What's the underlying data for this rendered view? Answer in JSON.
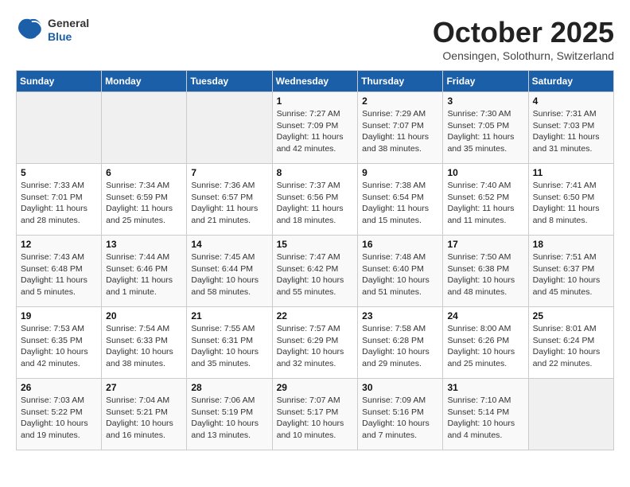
{
  "header": {
    "logo_general": "General",
    "logo_blue": "Blue",
    "title": "October 2025",
    "subtitle": "Oensingen, Solothurn, Switzerland"
  },
  "weekdays": [
    "Sunday",
    "Monday",
    "Tuesday",
    "Wednesday",
    "Thursday",
    "Friday",
    "Saturday"
  ],
  "weeks": [
    [
      {
        "day": "",
        "info": ""
      },
      {
        "day": "",
        "info": ""
      },
      {
        "day": "",
        "info": ""
      },
      {
        "day": "1",
        "info": "Sunrise: 7:27 AM\nSunset: 7:09 PM\nDaylight: 11 hours\nand 42 minutes."
      },
      {
        "day": "2",
        "info": "Sunrise: 7:29 AM\nSunset: 7:07 PM\nDaylight: 11 hours\nand 38 minutes."
      },
      {
        "day": "3",
        "info": "Sunrise: 7:30 AM\nSunset: 7:05 PM\nDaylight: 11 hours\nand 35 minutes."
      },
      {
        "day": "4",
        "info": "Sunrise: 7:31 AM\nSunset: 7:03 PM\nDaylight: 11 hours\nand 31 minutes."
      }
    ],
    [
      {
        "day": "5",
        "info": "Sunrise: 7:33 AM\nSunset: 7:01 PM\nDaylight: 11 hours\nand 28 minutes."
      },
      {
        "day": "6",
        "info": "Sunrise: 7:34 AM\nSunset: 6:59 PM\nDaylight: 11 hours\nand 25 minutes."
      },
      {
        "day": "7",
        "info": "Sunrise: 7:36 AM\nSunset: 6:57 PM\nDaylight: 11 hours\nand 21 minutes."
      },
      {
        "day": "8",
        "info": "Sunrise: 7:37 AM\nSunset: 6:56 PM\nDaylight: 11 hours\nand 18 minutes."
      },
      {
        "day": "9",
        "info": "Sunrise: 7:38 AM\nSunset: 6:54 PM\nDaylight: 11 hours\nand 15 minutes."
      },
      {
        "day": "10",
        "info": "Sunrise: 7:40 AM\nSunset: 6:52 PM\nDaylight: 11 hours\nand 11 minutes."
      },
      {
        "day": "11",
        "info": "Sunrise: 7:41 AM\nSunset: 6:50 PM\nDaylight: 11 hours\nand 8 minutes."
      }
    ],
    [
      {
        "day": "12",
        "info": "Sunrise: 7:43 AM\nSunset: 6:48 PM\nDaylight: 11 hours\nand 5 minutes."
      },
      {
        "day": "13",
        "info": "Sunrise: 7:44 AM\nSunset: 6:46 PM\nDaylight: 11 hours\nand 1 minute."
      },
      {
        "day": "14",
        "info": "Sunrise: 7:45 AM\nSunset: 6:44 PM\nDaylight: 10 hours\nand 58 minutes."
      },
      {
        "day": "15",
        "info": "Sunrise: 7:47 AM\nSunset: 6:42 PM\nDaylight: 10 hours\nand 55 minutes."
      },
      {
        "day": "16",
        "info": "Sunrise: 7:48 AM\nSunset: 6:40 PM\nDaylight: 10 hours\nand 51 minutes."
      },
      {
        "day": "17",
        "info": "Sunrise: 7:50 AM\nSunset: 6:38 PM\nDaylight: 10 hours\nand 48 minutes."
      },
      {
        "day": "18",
        "info": "Sunrise: 7:51 AM\nSunset: 6:37 PM\nDaylight: 10 hours\nand 45 minutes."
      }
    ],
    [
      {
        "day": "19",
        "info": "Sunrise: 7:53 AM\nSunset: 6:35 PM\nDaylight: 10 hours\nand 42 minutes."
      },
      {
        "day": "20",
        "info": "Sunrise: 7:54 AM\nSunset: 6:33 PM\nDaylight: 10 hours\nand 38 minutes."
      },
      {
        "day": "21",
        "info": "Sunrise: 7:55 AM\nSunset: 6:31 PM\nDaylight: 10 hours\nand 35 minutes."
      },
      {
        "day": "22",
        "info": "Sunrise: 7:57 AM\nSunset: 6:29 PM\nDaylight: 10 hours\nand 32 minutes."
      },
      {
        "day": "23",
        "info": "Sunrise: 7:58 AM\nSunset: 6:28 PM\nDaylight: 10 hours\nand 29 minutes."
      },
      {
        "day": "24",
        "info": "Sunrise: 8:00 AM\nSunset: 6:26 PM\nDaylight: 10 hours\nand 25 minutes."
      },
      {
        "day": "25",
        "info": "Sunrise: 8:01 AM\nSunset: 6:24 PM\nDaylight: 10 hours\nand 22 minutes."
      }
    ],
    [
      {
        "day": "26",
        "info": "Sunrise: 7:03 AM\nSunset: 5:22 PM\nDaylight: 10 hours\nand 19 minutes."
      },
      {
        "day": "27",
        "info": "Sunrise: 7:04 AM\nSunset: 5:21 PM\nDaylight: 10 hours\nand 16 minutes."
      },
      {
        "day": "28",
        "info": "Sunrise: 7:06 AM\nSunset: 5:19 PM\nDaylight: 10 hours\nand 13 minutes."
      },
      {
        "day": "29",
        "info": "Sunrise: 7:07 AM\nSunset: 5:17 PM\nDaylight: 10 hours\nand 10 minutes."
      },
      {
        "day": "30",
        "info": "Sunrise: 7:09 AM\nSunset: 5:16 PM\nDaylight: 10 hours\nand 7 minutes."
      },
      {
        "day": "31",
        "info": "Sunrise: 7:10 AM\nSunset: 5:14 PM\nDaylight: 10 hours\nand 4 minutes."
      },
      {
        "day": "",
        "info": ""
      }
    ]
  ]
}
